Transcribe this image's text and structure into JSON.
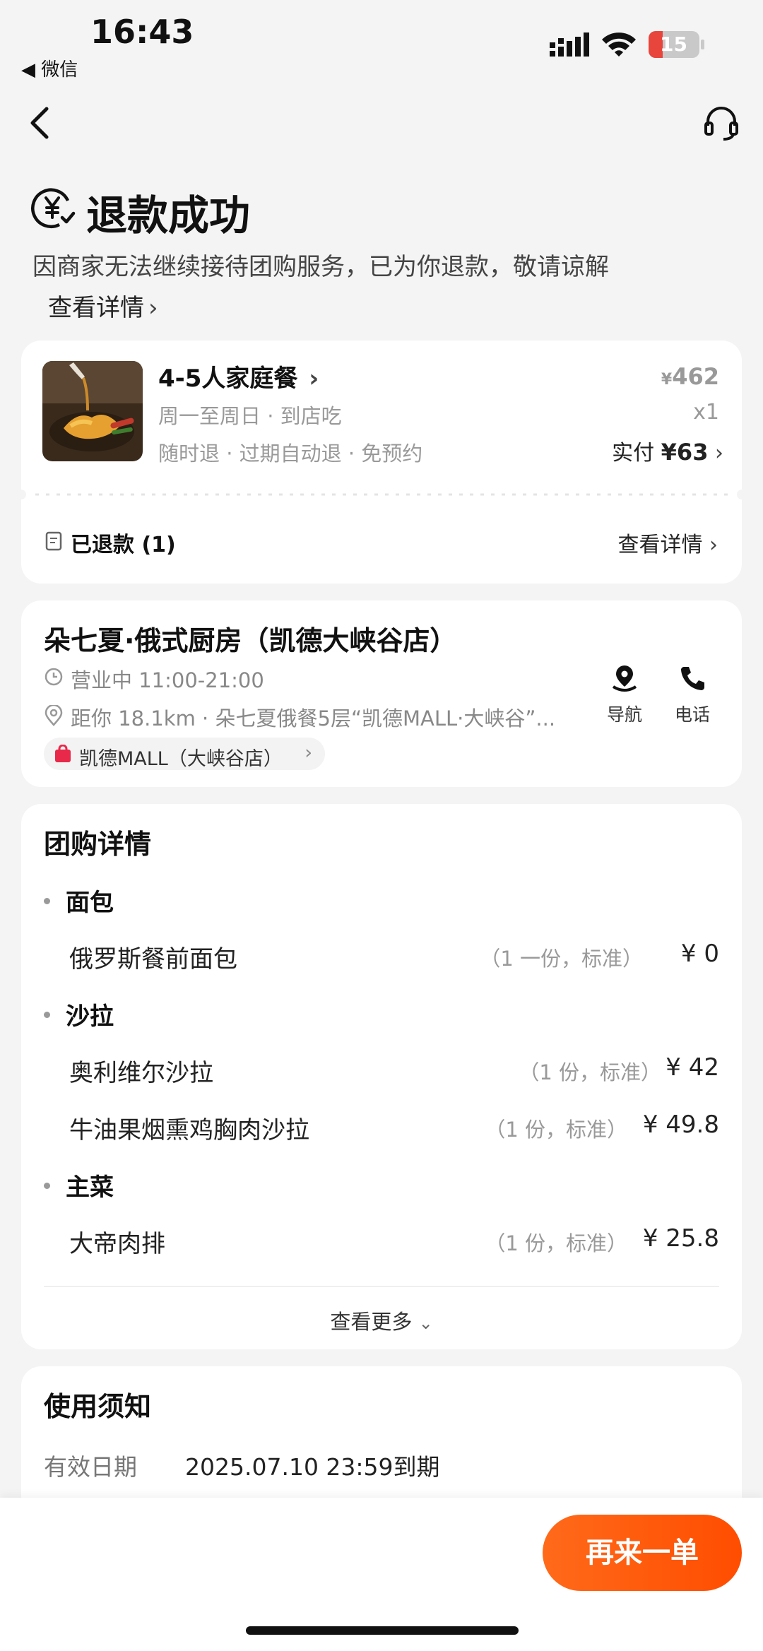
{
  "status_bar": {
    "time": "16:43",
    "back_app": "◀ 微信",
    "battery": "15"
  },
  "header": {
    "title": "退款成功",
    "description": "因商家无法继续接待团购服务，已为你退款，敬请谅解",
    "detail_link": "查看详情"
  },
  "order": {
    "name": "4-5人家庭餐",
    "time": "周一至周日 · 到店吃",
    "tags": "随时退 · 过期自动退 · 免预约",
    "price_symbol": "¥",
    "price": "462",
    "quantity": "x1",
    "paid_label": "实付",
    "paid_amount": "¥63",
    "refunded_label": "已退款 (1)",
    "refund_detail": "查看详情"
  },
  "store": {
    "name": "朵七夏·俄式厨房（凯德大峡谷店）",
    "hours": "营业中 11:00-21:00",
    "address": "距你 18.1km ·  朵七夏俄餐5层“凯德MALL·大峡谷”...",
    "mall": "凯德MALL（大峡谷店）",
    "nav_label": "导航",
    "call_label": "电话"
  },
  "deal": {
    "title": "团购详情",
    "categories": [
      {
        "name": "面包",
        "items": [
          {
            "name": "俄罗斯餐前面包",
            "spec": "（1 一份，标准）",
            "price": "¥ 0"
          }
        ]
      },
      {
        "name": "沙拉",
        "items": [
          {
            "name": "奥利维尔沙拉",
            "spec": "（1 份，标准）",
            "price": "¥ 42"
          },
          {
            "name": "牛油果烟熏鸡胸肉沙拉",
            "spec": "（1 份，标准）",
            "price": "¥ 49.8"
          }
        ]
      },
      {
        "name": "主菜",
        "items": [
          {
            "name": "大帝肉排",
            "spec": "（1 份，标准）",
            "price": "¥ 25.8"
          }
        ]
      }
    ],
    "more": "查看更多"
  },
  "notice": {
    "title": "使用须知",
    "valid_label": "有效日期",
    "valid_value": "2025.07.10 23:59到期"
  },
  "bottom": {
    "reorder": "再来一单"
  },
  "colors": {
    "accent": "#ff5a0f",
    "battery_red": "#e8453c"
  }
}
